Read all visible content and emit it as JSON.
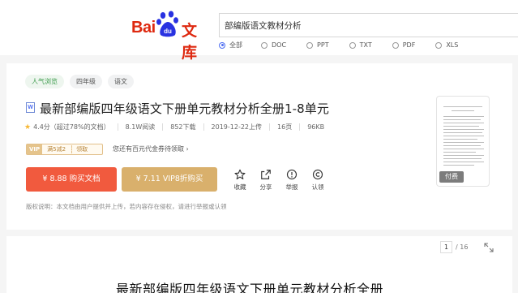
{
  "header": {
    "logo_bai": "Bai",
    "logo_du": "du",
    "logo_wenku": "文库",
    "search_value": "部编版语文教材分析",
    "filters": [
      "全部",
      "DOC",
      "PPT",
      "TXT",
      "PDF",
      "XLS"
    ],
    "selected_filter": "全部"
  },
  "doc": {
    "tags": [
      "人气浏览",
      "四年级",
      "语文"
    ],
    "type_icon": "W",
    "title": "最新部编版四年级语文下册单元教材分析全册1-8单元",
    "rating": "4.4分（超过78%的文档）",
    "reads": "8.1W阅读",
    "downloads": "852下载",
    "date": "2019-12-22上传",
    "pages": "16页",
    "size": "96KB",
    "coupon": {
      "vip": "VIP",
      "text": "满5减2",
      "claim": "领取"
    },
    "coupon_tip": "您还有百元代金券待领取",
    "buy_button": "¥ 8.88 购买文档",
    "vip_button": "¥ 7.11 VIP8折购买",
    "actions": [
      "收藏",
      "分享",
      "举报",
      "认领"
    ],
    "notice": "版权说明：本文档由用户提供并上传，若内容存在侵权，请进行举报或认领",
    "thumb_badge": "付费"
  },
  "preview": {
    "current_page": "1",
    "total_pages": "/ 16",
    "heading": "最新部编版四年级语文下册单元教材分析全册"
  },
  "colors": {
    "brand_red": "#de2910",
    "buy": "#f15a3e",
    "vip": "#d9b06c",
    "accent_blue": "#4e6ef2"
  }
}
